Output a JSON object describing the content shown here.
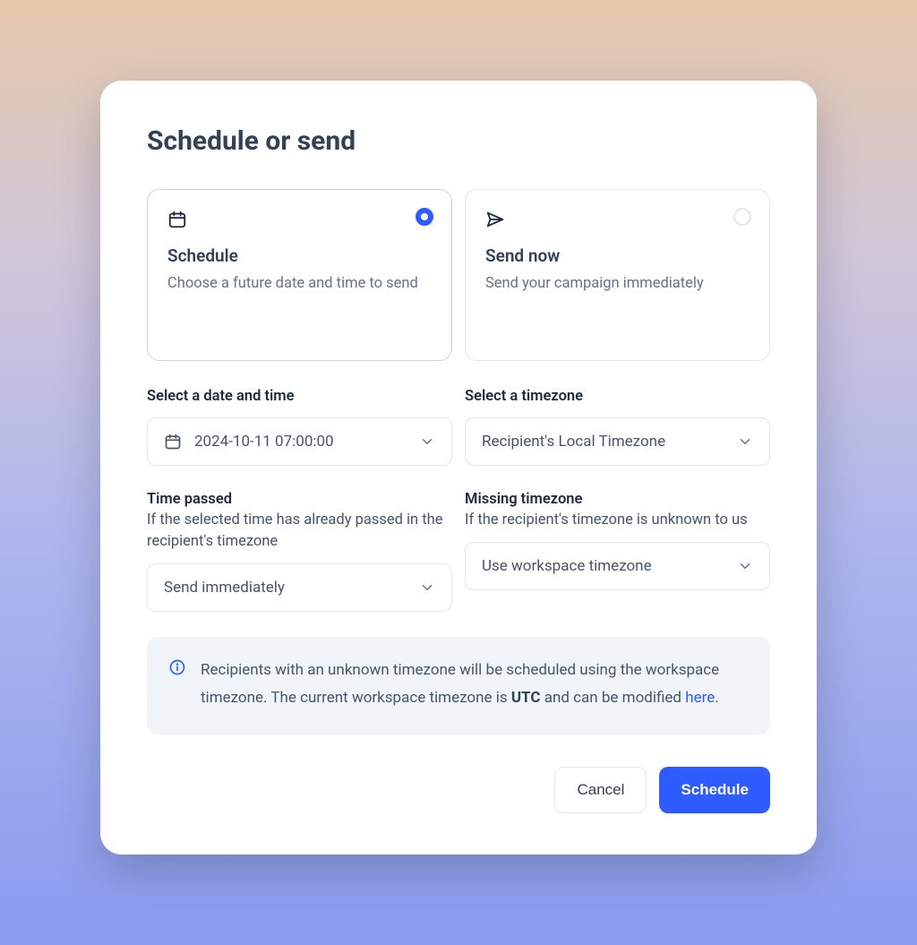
{
  "dialog": {
    "title": "Schedule or send",
    "options": {
      "schedule": {
        "title": "Schedule",
        "description": "Choose a future date and time to send",
        "selected": true
      },
      "send_now": {
        "title": "Send now",
        "description": "Send your campaign immediately",
        "selected": false
      }
    },
    "fields": {
      "datetime": {
        "label": "Select a date and time",
        "value": "2024-10-11 07:00:00"
      },
      "timezone": {
        "label": "Select a timezone",
        "value": "Recipient's Local Timezone"
      },
      "time_passed": {
        "label": "Time passed",
        "sublabel": "If the selected time has already passed in the recipient's timezone",
        "value": "Send immediately"
      },
      "missing_timezone": {
        "label": "Missing timezone",
        "sublabel": "If the recipient's timezone is unknown to us",
        "value": "Use workspace timezone"
      }
    },
    "info": {
      "text_pre": "Recipients with an unknown timezone will be scheduled using the workspace timezone. The current workspace timezone is ",
      "bold": "UTC",
      "text_mid": " and can be modified ",
      "link": "here",
      "text_post": "."
    },
    "buttons": {
      "cancel": "Cancel",
      "confirm": "Schedule"
    }
  }
}
